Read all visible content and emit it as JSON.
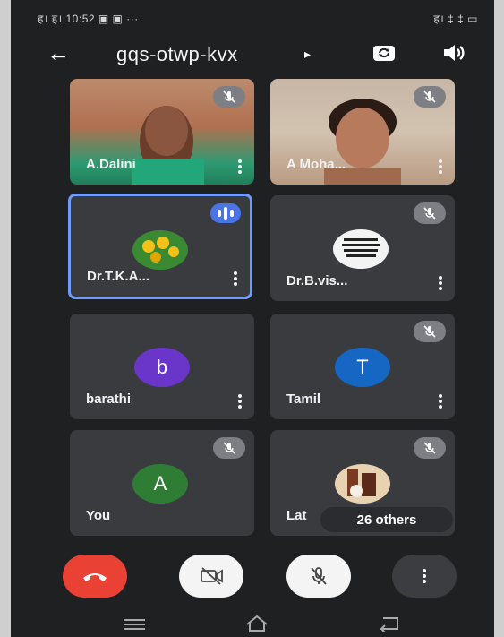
{
  "status_bar": {
    "left": "ह। ह। 10:52 ▣ ▣ ···",
    "right": "ह। ‡ ‡ ▭"
  },
  "header": {
    "meeting_code": "gqs-otwp-kvx",
    "icons": [
      "back-arrow-icon",
      "chevron-right-icon",
      "camera-switch-icon",
      "speaker-icon"
    ]
  },
  "participants": [
    {
      "name": "A.Dalini",
      "type": "video",
      "muted": true
    },
    {
      "name": "A Moha...",
      "type": "video",
      "muted": true
    },
    {
      "name": "Dr.T.K.A...",
      "type": "photo",
      "muted": false,
      "speaking": true
    },
    {
      "name": "Dr.B.vis...",
      "type": "photo",
      "muted": true
    },
    {
      "name": "barathi",
      "type": "letter",
      "letter": "b",
      "color": "#6a35c9",
      "muted": false
    },
    {
      "name": "Tamil",
      "type": "letter",
      "letter": "T",
      "color": "#1667c4",
      "muted": true
    },
    {
      "name": "You",
      "type": "letter",
      "letter": "A",
      "color": "#2f7d34",
      "muted": true
    },
    {
      "name": "Lat",
      "type": "photo",
      "muted": true
    }
  ],
  "others_pill": "26 others",
  "controls": [
    "end-call-icon",
    "camera-off-icon",
    "mic-off-icon",
    "more-vert-icon"
  ],
  "colors": {
    "background": "#1f2022",
    "tile": "#3a3b3e",
    "end_call": "#e94235",
    "active_border": "#6d9cff"
  }
}
